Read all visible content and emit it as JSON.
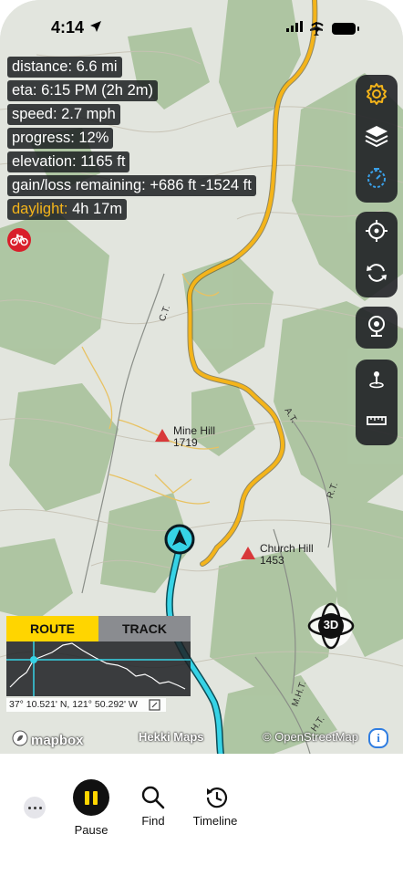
{
  "status_bar": {
    "time": "4:14"
  },
  "stats": {
    "distance": "distance:  6.6 mi",
    "eta": "eta:  6:15 PM (2h 2m)",
    "speed": "speed:  2.7 mph",
    "progress": "progress:  12%",
    "elevation": "elevation:  1165 ft",
    "gain_loss": "gain/loss remaining:  +686 ft -1524 ft",
    "daylight_label": "daylight:",
    "daylight_value": "4h 17m"
  },
  "map_labels": {
    "mine_hill_name": "Mine Hill",
    "mine_hill_elev": "1719",
    "church_hill_name": "Church Hill",
    "church_hill_elev": "1453",
    "trail_ct": "C.T.",
    "trail_at": "A.T.",
    "trail_rt": "R.T.",
    "trail_mht": "M.H.T.",
    "trail_ht": "H.T."
  },
  "toolbar": {
    "icons": [
      "gear-icon",
      "layers-icon",
      "timer-icon",
      "crosshair-icon",
      "refresh-icon",
      "webcam-icon",
      "waypoint-icon",
      "ruler-icon"
    ]
  },
  "button_3d": "3D",
  "route_panel": {
    "tab_route": "ROUTE",
    "tab_track": "TRACK",
    "coordinates": "37° 10.521' N, 121° 50.292' W"
  },
  "attribution": {
    "mapbox": "mapbox",
    "hekki": "Hekki Maps",
    "osm": "© OpenStreetMap",
    "info": "i"
  },
  "bottom_bar": {
    "pause_label": "Pause",
    "find_label": "Find",
    "timeline_label": "Timeline"
  },
  "colors": {
    "route_yellow": "#f4b41a",
    "track_cyan": "#36d3e6",
    "accent_tab": "#ffd500",
    "bike_red": "#d91e2a"
  }
}
